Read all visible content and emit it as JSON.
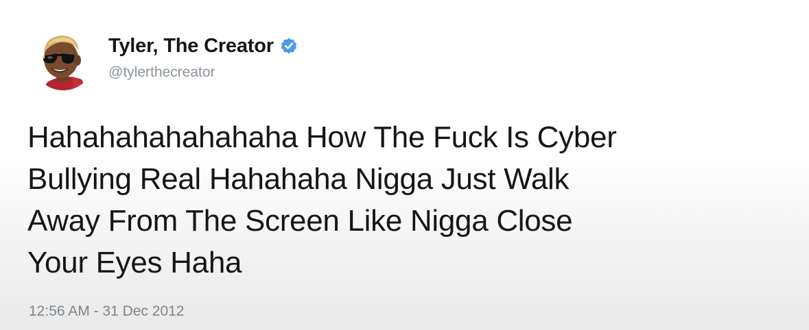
{
  "tweet": {
    "author": {
      "display_name": "Tyler, The Creator",
      "handle": "@tylerthecreator",
      "verified": true,
      "avatar_icon": "avatar-icon"
    },
    "text_lines": [
      "Hahahahahahahaha How The Fuck Is Cyber",
      "Bullying Real Hahahaha Nigga Just Walk",
      "Away From The Screen Like Nigga Close",
      "Your Eyes Haha"
    ],
    "timestamp": "12:56 AM - 31 Dec 2012"
  },
  "colors": {
    "verified_badge": "#4a9be8",
    "name": "#14171a",
    "secondary_text": "#8c9399"
  }
}
